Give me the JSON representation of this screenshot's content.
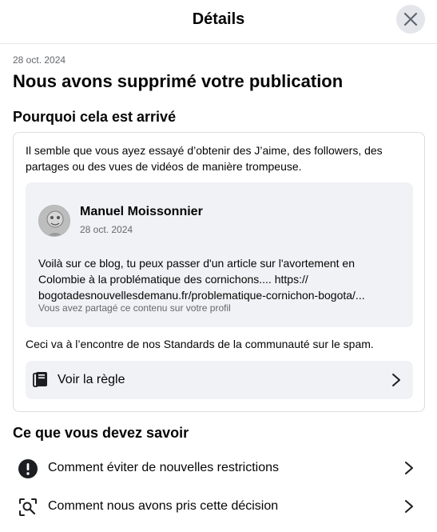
{
  "header": {
    "title": "Détails",
    "close_icon": "close-icon"
  },
  "notice": {
    "date": "28 oct. 2024",
    "title": "Nous avons supprimé votre publication"
  },
  "why": {
    "title": "Pourquoi cela est arrivé",
    "description": "Il semble que vous ayez essayé d’obtenir des J’aime, des followers, des partages ou des vues de vidéos de manière trompeuse.",
    "post": {
      "author": "Manuel Moissonnier",
      "date": "28 oct. 2024",
      "text_lines": [
        "Voilà sur ce blog, tu peux passer d'un article sur l'avortement en",
        "Colombie à la problématique des cornichons.... https://",
        "bogotadesnouvellesdemanu.fr/problematique-cornichon-bogota/..."
      ],
      "shared_note": "Vous avez partagé ce contenu sur votre profil"
    },
    "standards_text": "Ceci va à l’encontre de nos Standards de la communauté sur le spam.",
    "rule_button": {
      "label": "Voir la règle",
      "icon": "rule-book-icon"
    }
  },
  "know": {
    "title": "Ce que vous devez savoir",
    "items": [
      {
        "label": "Comment éviter de nouvelles restrictions",
        "icon": "exclamation-circle-icon"
      },
      {
        "label": "Comment nous avons pris cette décision",
        "icon": "search-scan-icon"
      }
    ]
  },
  "colors": {
    "primary_text": "#050505",
    "secondary_text": "#65676b",
    "surface": "#f0f2f5",
    "divider": "#e4e6eb"
  }
}
